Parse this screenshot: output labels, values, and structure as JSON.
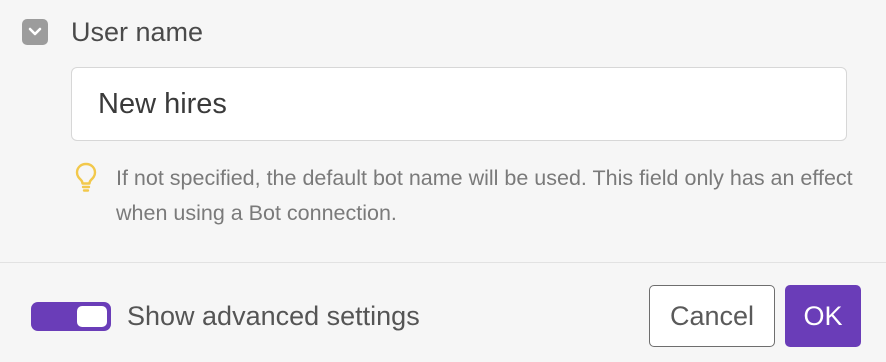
{
  "field": {
    "label": "User name",
    "collapse_icon": "chevron-down-icon",
    "value": "New hires",
    "hint_icon": "lightbulb-icon",
    "hint": "If not specified, the default bot name will be used. This field only has an effect when using a Bot connection."
  },
  "footer": {
    "advanced_toggle_label": "Show advanced settings",
    "advanced_toggle_on": true,
    "cancel_label": "Cancel",
    "ok_label": "OK"
  },
  "colors": {
    "accent": "#6a3db8",
    "hint_icon": "#f2c84b",
    "background": "#f6f6f6"
  }
}
